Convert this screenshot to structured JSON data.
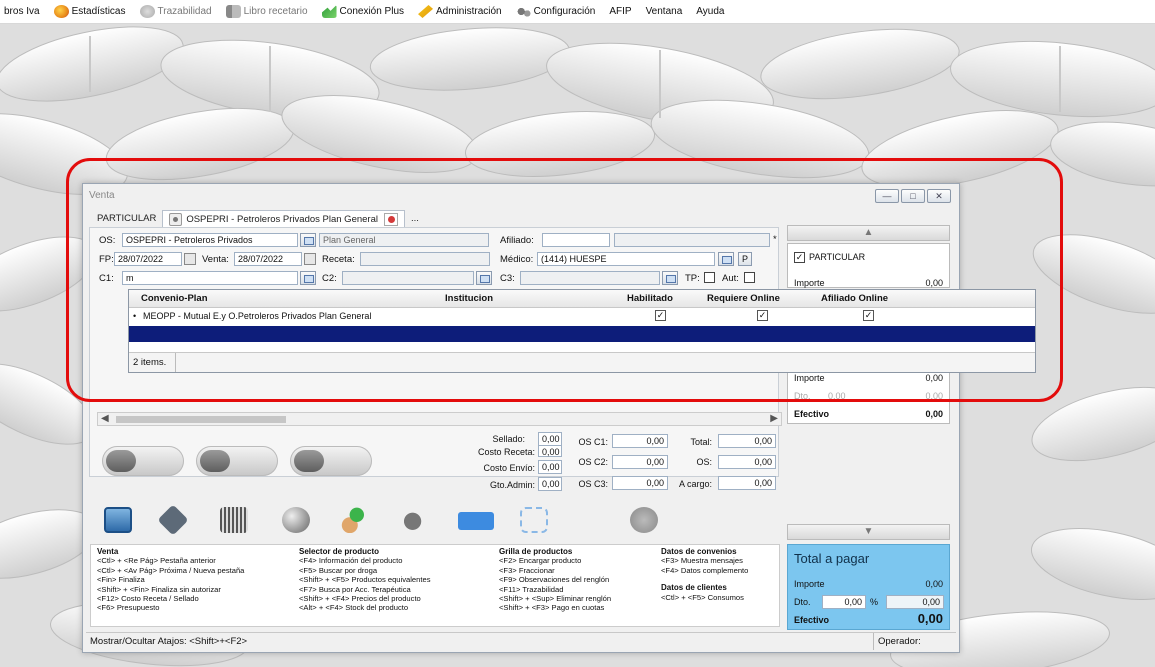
{
  "menu": {
    "items": [
      {
        "label": "bros Iva",
        "icon": "none",
        "disabled": false
      },
      {
        "label": "Estadísticas",
        "icon": "stats-icon",
        "disabled": false
      },
      {
        "label": "Trazabilidad",
        "icon": "traceability-icon",
        "disabled": true
      },
      {
        "label": "Libro recetario",
        "icon": "book-icon",
        "disabled": true
      },
      {
        "label": "Conexión Plus",
        "icon": "connection-icon",
        "disabled": false
      },
      {
        "label": "Administración",
        "icon": "admin-icon",
        "disabled": false
      },
      {
        "label": "Configuración",
        "icon": "config-icon",
        "disabled": false
      },
      {
        "label": "AFIP",
        "icon": "none",
        "disabled": false
      },
      {
        "label": "Ventana",
        "icon": "none",
        "disabled": false
      },
      {
        "label": "Ayuda",
        "icon": "none",
        "disabled": false
      }
    ]
  },
  "window": {
    "title": "Venta",
    "tabs": [
      {
        "label": "PARTICULAR"
      },
      {
        "label": "OSPEPRI - Petroleros Privados Plan General"
      },
      {
        "label": "..."
      }
    ]
  },
  "form": {
    "os_label": "OS:",
    "os_value": "OSPEPRI - Petroleros Privados",
    "plan_value": "Plan General",
    "afiliado_label": "Afiliado:",
    "asterisk": "*",
    "fp_label": "FP:",
    "fp_value": "28/07/2022",
    "venta_label": "Venta:",
    "venta_value": "28/07/2022",
    "receta_label": "Receta:",
    "medico_label": "Médico:",
    "medico_value": "(1414) HUESPE",
    "p_label": "P",
    "c1_label": "C1:",
    "c1_value": "m",
    "c2_label": "C2:",
    "c3_label": "C3:",
    "tp_label": "TP:",
    "aut_label": "Aut:"
  },
  "dropdown": {
    "columns": [
      "Convenio-Plan",
      "Institucion",
      "Habilitado",
      "Requiere Online",
      "Afiliado Online"
    ],
    "row_marker": "•",
    "rows": [
      {
        "plan": "MEOPP - Mutual E.y O.Petroleros Privados Plan General",
        "institucion": "",
        "habilitado": true,
        "requiere_online": true,
        "afiliado_online": true
      }
    ],
    "footer": "2 items."
  },
  "totals": {
    "sellado_label": "Sellado:",
    "sellado": "0,00",
    "costo_receta_label": "Costo Receta:",
    "costo_receta": "0,00",
    "costo_envio_label": "Costo Envío:",
    "costo_envio": "0,00",
    "gto_admin_label": "Gto.Admin:",
    "gto_admin": "0,00",
    "os_c1_label": "OS C1:",
    "os_c1": "0,00",
    "os_c2_label": "OS C2:",
    "os_c2": "0,00",
    "os_c3_label": "OS C3:",
    "os_c3": "0,00",
    "total_label": "Total:",
    "total": "0,00",
    "os_label": "OS:",
    "os": "0,00",
    "a_cargo_label": "A cargo:",
    "a_cargo": "0,00"
  },
  "shortcuts": {
    "venta": {
      "title": "Venta",
      "lines": [
        "<Ctl> + <Re Pág>  Pestaña anterior",
        "<Ctl> + <Av Pág>  Próxima / Nueva pestaña",
        "<Fin>              Finaliza",
        "<Shift> + <Fin>   Finaliza sin autorizar",
        "<F12>             Costo Receta / Sellado",
        "<F6>              Presupuesto"
      ]
    },
    "selector": {
      "title": "Selector de producto",
      "lines": [
        "<F4>          Información del producto",
        "<F5>          Buscar por droga",
        "<Shift> + <F5>  Productos equivalentes",
        "<F7>          Busca por Acc. Terapéutica",
        "<Shift> + <F4>  Precios del producto",
        "<Alt> + <F4>   Stock del producto"
      ]
    },
    "grilla": {
      "title": "Grilla de productos",
      "lines": [
        "<F2>   Encargar producto",
        "<F3>   Fraccionar",
        "<F9>   Observaciones del renglón",
        "<F11>  Trazabilidad",
        "<Shift> + <Sup>  Eliminar renglón",
        "<Shift> + <F3>   Pago en cuotas"
      ]
    },
    "convenios": {
      "title": "Datos de convenios",
      "lines": [
        "<F3>  Muestra mensajes",
        "<F4>  Datos complemento"
      ]
    },
    "clientes": {
      "title": "Datos de clientes",
      "lines": [
        "<Ctl> + <F5>  Consumos"
      ]
    }
  },
  "status": {
    "left": "Mostrar/Ocultar Atajos: <Shift>+<F2>",
    "right": "Operador:"
  },
  "right_panel": {
    "particular_label": "PARTICULAR",
    "importe_label": "Importe",
    "importe_top": "0,00",
    "importe_mid": "0,00",
    "dto_label": "Dto.",
    "dto_value": "0,00",
    "pct": "%",
    "dto_amount": "0,00",
    "efectivo_label": "Efectivo",
    "efectivo_mid": "0,00",
    "total_title": "Total a pagar",
    "total_importe": "0,00",
    "total_dto": "0,00",
    "total_dto_amount": "0,00",
    "total_efectivo": "0,00"
  },
  "colors": {
    "highlight": "#e30c0c",
    "selection": "#0d1d7a",
    "total_panel": "#7cc6ef"
  }
}
